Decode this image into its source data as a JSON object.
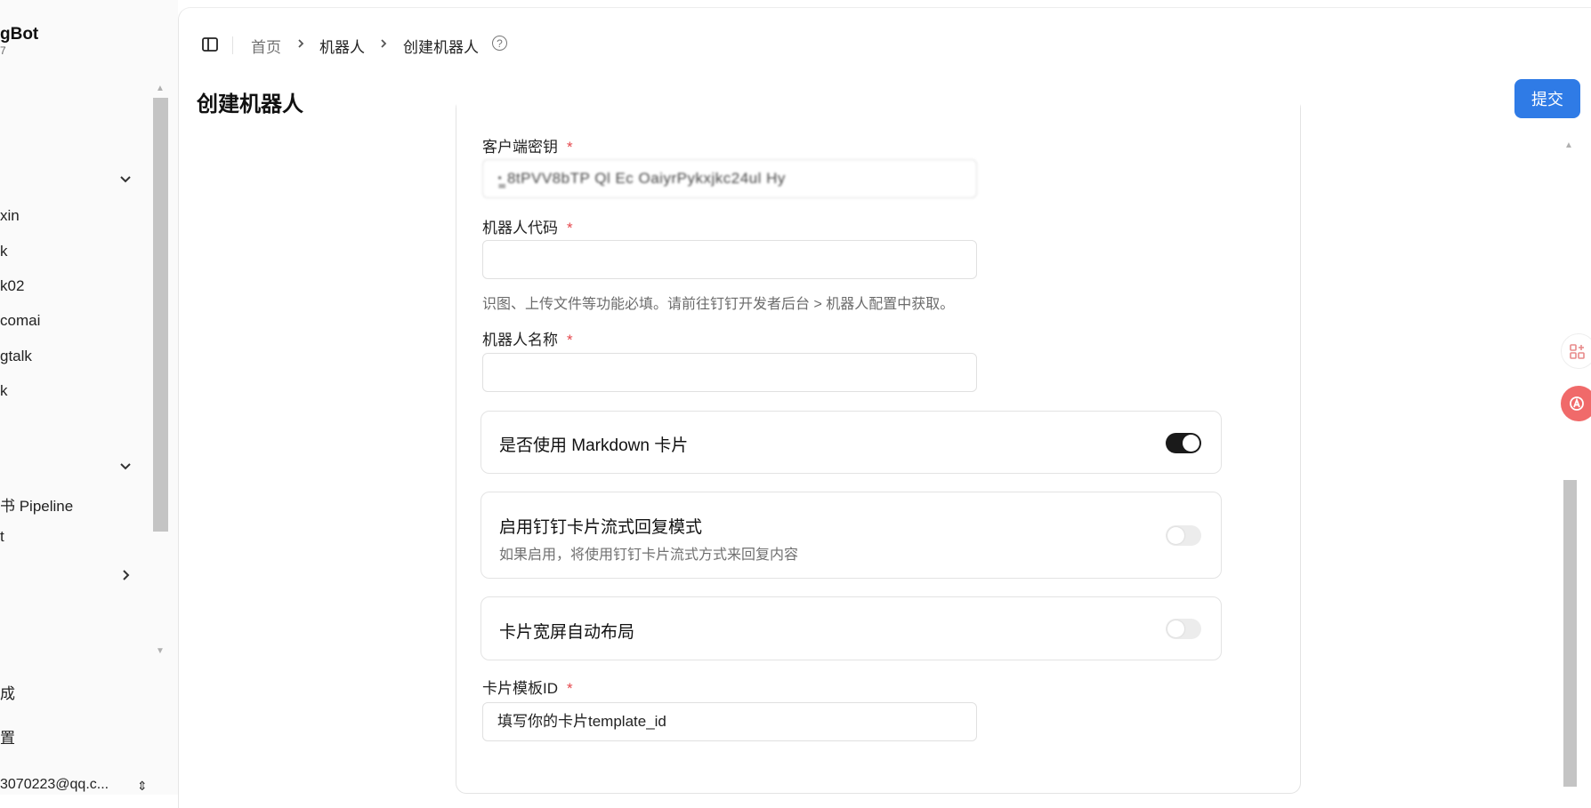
{
  "sidebar": {
    "brand": "gBot",
    "brand_sub": "7",
    "items": [
      {
        "label": "xin"
      },
      {
        "label": "k"
      },
      {
        "label": "k02"
      },
      {
        "label": "comai"
      },
      {
        "label": "gtalk"
      },
      {
        "label": "k"
      },
      {
        "label": "书 Pipeline"
      },
      {
        "label": "t"
      },
      {
        "label": "成"
      },
      {
        "label": "置"
      }
    ],
    "user": "3070223@qq.c..."
  },
  "header": {
    "breadcrumb": [
      "首页",
      "机器人",
      "创建机器人"
    ],
    "title": "创建机器人",
    "submit_label": "提交"
  },
  "form": {
    "client_secret": {
      "label": "客户端密钥",
      "required": "*",
      "value": "ꞏ̲̲ 8tPVV8bTP   Ql   Ec OaiyrPykxjkc24ul   Hy"
    },
    "robot_code": {
      "label": "机器人代码",
      "required": "*",
      "value": "",
      "hint": "识图、上传文件等功能必填。请前往钉钉开发者后台 > 机器人配置中获取。"
    },
    "robot_name": {
      "label": "机器人名称",
      "required": "*",
      "value": ""
    },
    "markdown_card": {
      "label": "是否使用 Markdown 卡片",
      "enabled": true
    },
    "stream_card": {
      "label": "启用钉钉卡片流式回复模式",
      "description": "如果启用，将使用钉钉卡片流式方式来回复内容",
      "enabled": false
    },
    "wide_card": {
      "label": "卡片宽屏自动布局",
      "enabled": false
    },
    "template_id": {
      "label": "卡片模板ID",
      "required": "*",
      "value": "填写你的卡片template_id"
    }
  },
  "colors": {
    "accent": "#2f7be6",
    "required": "#e5484d",
    "toggle_on": "#1a1a1a",
    "toggle_off": "#ececec"
  }
}
